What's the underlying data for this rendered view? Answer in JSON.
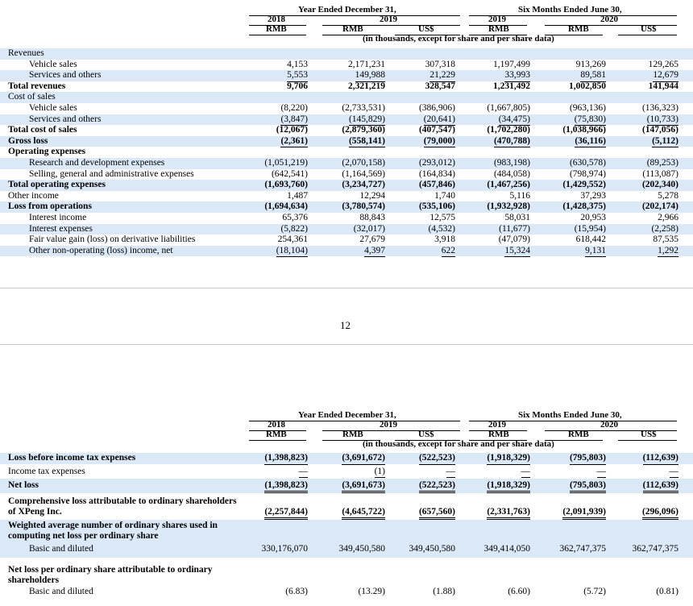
{
  "header": {
    "year_ended": "Year Ended December 31,",
    "six_months": "Six Months Ended June 30,",
    "years": [
      "2018",
      "2019",
      "2019",
      "2020"
    ],
    "currencies": [
      "RMB",
      "RMB",
      "US$",
      "RMB",
      "RMB",
      "US$"
    ],
    "units_note": "(in thousands, except for share and per share data)"
  },
  "page_number": "12",
  "table1": [
    {
      "label": "Revenues",
      "values": [
        "",
        "",
        "",
        "",
        "",
        ""
      ]
    },
    {
      "label": "Vehicle sales",
      "values": [
        "4,153",
        "2,171,231",
        "307,318",
        "1,197,499",
        "913,269",
        "129,265"
      ]
    },
    {
      "label": "Services and others",
      "values": [
        "5,553",
        "149,988",
        "21,229",
        "33,993",
        "89,581",
        "12,679"
      ]
    },
    {
      "label": "Total revenues",
      "values": [
        "9,706",
        "2,321,219",
        "328,547",
        "1,231,492",
        "1,002,850",
        "141,944"
      ]
    },
    {
      "label": "Cost of sales",
      "values": [
        "",
        "",
        "",
        "",
        "",
        ""
      ]
    },
    {
      "label": "Vehicle sales",
      "values": [
        "(8,220)",
        "(2,733,531)",
        "(386,906)",
        "(1,667,805)",
        "(963,136)",
        "(136,323)"
      ]
    },
    {
      "label": "Services and others",
      "values": [
        "(3,847)",
        "(145,829)",
        "(20,641)",
        "(34,475)",
        "(75,830)",
        "(10,733)"
      ]
    },
    {
      "label": "Total cost of sales",
      "values": [
        "(12,067)",
        "(2,879,360)",
        "(407,547)",
        "(1,702,280)",
        "(1,038,966)",
        "(147,056)"
      ]
    },
    {
      "label": "Gross loss",
      "values": [
        "(2,361)",
        "(558,141)",
        "(79,000)",
        "(470,788)",
        "(36,116)",
        "(5,112)"
      ]
    },
    {
      "label": "Operating expenses",
      "values": [
        "",
        "",
        "",
        "",
        "",
        ""
      ]
    },
    {
      "label": "Research and development expenses",
      "values": [
        "(1,051,219)",
        "(2,070,158)",
        "(293,012)",
        "(983,198)",
        "(630,578)",
        "(89,253)"
      ]
    },
    {
      "label": "Selling, general and administrative expenses",
      "values": [
        "(642,541)",
        "(1,164,569)",
        "(164,834)",
        "(484,058)",
        "(798,974)",
        "(113,087)"
      ]
    },
    {
      "label": "Total operating expenses",
      "values": [
        "(1,693,760)",
        "(3,234,727)",
        "(457,846)",
        "(1,467,256)",
        "(1,429,552)",
        "(202,340)"
      ]
    },
    {
      "label": "Other income",
      "values": [
        "1,487",
        "12,294",
        "1,740",
        "5,116",
        "37,293",
        "5,278"
      ]
    },
    {
      "label": "Loss from operations",
      "values": [
        "(1,694,634)",
        "(3,780,574)",
        "(535,106)",
        "(1,932,928)",
        "(1,428,375)",
        "(202,174)"
      ]
    },
    {
      "label": "Interest income",
      "values": [
        "65,376",
        "88,843",
        "12,575",
        "58,031",
        "20,953",
        "2,966"
      ]
    },
    {
      "label": "Interest expenses",
      "values": [
        "(5,822)",
        "(32,017)",
        "(4,532)",
        "(11,677)",
        "(15,954)",
        "(2,258)"
      ]
    },
    {
      "label": "Fair value gain (loss) on derivative liabilities",
      "values": [
        "254,361",
        "27,679",
        "3,918",
        "(47,079)",
        "618,442",
        "87,535"
      ]
    },
    {
      "label": "Other non-operating (loss) income, net",
      "values": [
        "(18,104)",
        "4,397",
        "622",
        "15,324",
        "9,131",
        "1,292"
      ]
    }
  ],
  "table2": [
    {
      "label": "Loss before income tax expenses",
      "values": [
        "(1,398,823)",
        "(3,691,672)",
        "(522,523)",
        "(1,918,329)",
        "(795,803)",
        "(112,639)"
      ]
    },
    {
      "label": "Income tax expenses",
      "values": [
        "—",
        "(1)",
        "—",
        "—",
        "—",
        "—"
      ]
    },
    {
      "label": "Net loss",
      "values": [
        "(1,398,823)",
        "(3,691,673)",
        "(522,523)",
        "(1,918,329)",
        "(795,803)",
        "(112,639)"
      ]
    },
    {
      "label": "Comprehensive loss attributable to ordinary shareholders of XPeng Inc.",
      "values": [
        "(2,257,844)",
        "(4,645,722)",
        "(657,560)",
        "(2,331,763)",
        "(2,091,939)",
        "(296,096)"
      ]
    },
    {
      "label": "Weighted average number of ordinary shares used in computing net loss per ordinary share",
      "values": [
        "",
        "",
        "",
        "",
        "",
        ""
      ]
    },
    {
      "label": "Basic and diluted",
      "values": [
        "330,176,070",
        "349,450,580",
        "349,450,580",
        "349,414,050",
        "362,747,375",
        "362,747,375"
      ]
    },
    {
      "label": "Net loss per ordinary share attributable to ordinary shareholders",
      "values": [
        "",
        "",
        "",
        "",
        "",
        ""
      ]
    },
    {
      "label": "Basic and diluted",
      "values": [
        "(6.83)",
        "(13.29)",
        "(1.88)",
        "(6.60)",
        "(5.72)",
        "(0.81)"
      ]
    }
  ]
}
